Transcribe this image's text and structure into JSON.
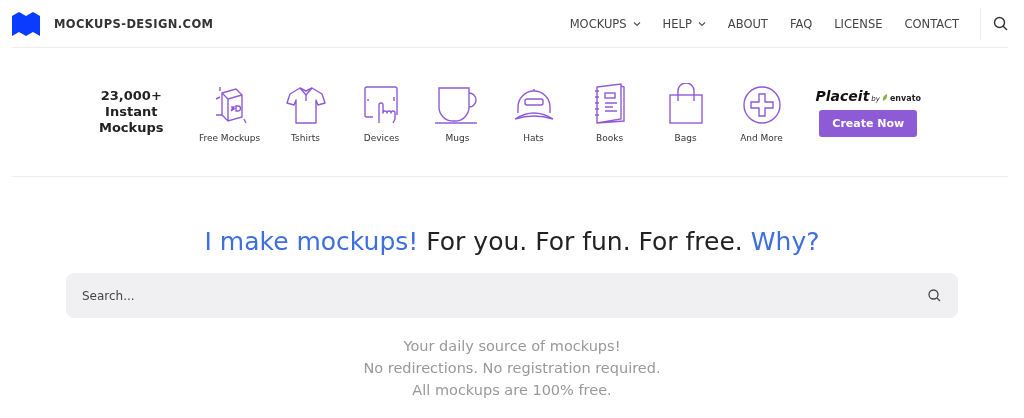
{
  "header": {
    "site_name": "MOCKUPS-DESIGN.COM",
    "nav": [
      {
        "label": "MOCKUPS",
        "dropdown": true
      },
      {
        "label": "HELP",
        "dropdown": true
      },
      {
        "label": "ABOUT",
        "dropdown": false
      },
      {
        "label": "FAQ",
        "dropdown": false
      },
      {
        "label": "LICENSE",
        "dropdown": false
      },
      {
        "label": "CONTACT",
        "dropdown": false
      }
    ]
  },
  "promo": {
    "headline": [
      "23,000+",
      "Instant",
      "Mockups"
    ],
    "categories": [
      {
        "label": "Free Mockups",
        "kind": "cube"
      },
      {
        "label": "Tshirts",
        "kind": "tshirt"
      },
      {
        "label": "Devices",
        "kind": "tablet"
      },
      {
        "label": "Mugs",
        "kind": "mug"
      },
      {
        "label": "Hats",
        "kind": "cap"
      },
      {
        "label": "Books",
        "kind": "book"
      },
      {
        "label": "Bags",
        "kind": "bag"
      },
      {
        "label": "And More",
        "kind": "plus"
      }
    ],
    "brand": {
      "name": "Placeit",
      "by": "by",
      "partner": "envato"
    },
    "cta": "Create Now"
  },
  "hero": {
    "headline": [
      {
        "text": "I make mockups!",
        "kind": "accent"
      },
      {
        "text": "For you. For fun. For free.",
        "kind": "plain"
      },
      {
        "text": "Why?",
        "kind": "link"
      }
    ],
    "search": {
      "placeholder": "Search..."
    },
    "tagline": [
      "Your daily source of mockups!",
      "No redirections. No registration required.",
      "All mockups are 100% free."
    ]
  }
}
